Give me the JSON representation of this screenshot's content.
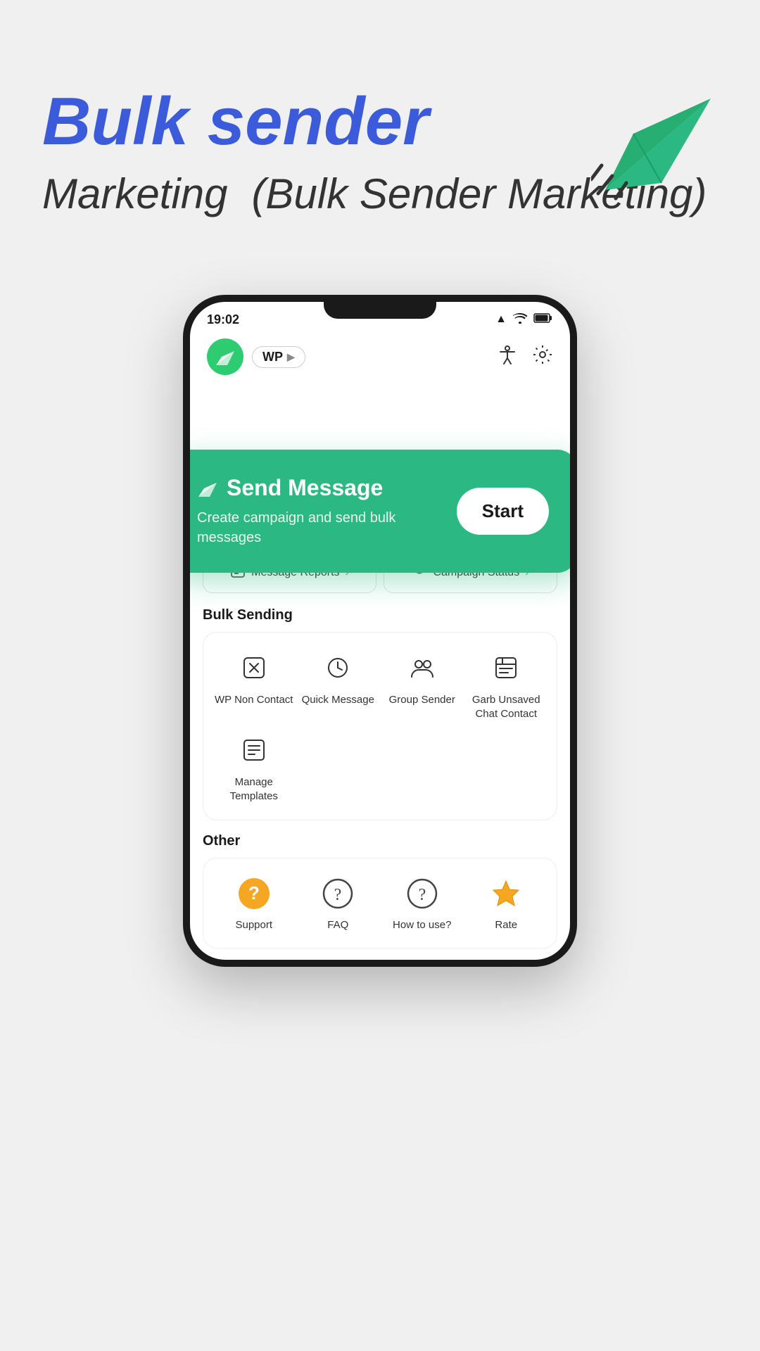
{
  "header": {
    "title_line1": "Bulk sender",
    "title_line2": "Marketing",
    "title_subtitle": "(Bulk Sender Marketing)"
  },
  "status_bar": {
    "time": "19:02",
    "signal": "▲",
    "wifi": "WiFi",
    "battery": "🔋"
  },
  "app_header": {
    "wp_label": "WP",
    "wp_arrow": "▶"
  },
  "send_message_card": {
    "icon": "▶",
    "title": "Send Message",
    "description": "Create campaign and send bulk messages",
    "button_label": "Start"
  },
  "quick_actions": [
    {
      "icon": "📋",
      "label": "Message Reports",
      "arrow": "›"
    },
    {
      "icon": "📢",
      "label": "Campaign Status",
      "arrow": "›",
      "arrow_color": "#2ecc71"
    }
  ],
  "bulk_sending": {
    "section_title": "Bulk Sending",
    "items": [
      {
        "icon": "✖️",
        "label": "WP Non Contact"
      },
      {
        "icon": "⏰",
        "label": "Quick Message"
      },
      {
        "icon": "👥",
        "label": "Group Sender"
      },
      {
        "icon": "📋",
        "label": "Garb Unsaved Chat Contact"
      },
      {
        "icon": "📄",
        "label": "Manage Templates"
      }
    ]
  },
  "other": {
    "section_title": "Other",
    "items": [
      {
        "icon": "❓",
        "label": "Support",
        "icon_color": "#f5a623"
      },
      {
        "icon": "❓",
        "label": "FAQ",
        "icon_color": "#555"
      },
      {
        "icon": "❓",
        "label": "How to use?",
        "icon_color": "#555"
      },
      {
        "icon": "⭐",
        "label": "Rate",
        "icon_color": "#f5a623"
      }
    ]
  }
}
